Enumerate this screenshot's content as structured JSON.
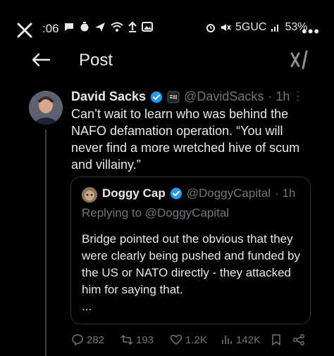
{
  "status_bar": {
    "time": ":06",
    "network": "5GUC",
    "battery": "53%",
    "more": "•••"
  },
  "header": {
    "title": "Post",
    "brand_icon": "grok-icon"
  },
  "tweet": {
    "author_name": "David Sacks",
    "handle": "@DavidSacks",
    "time": "· 1h",
    "body": "Can’t wait to learn who was behind the NAFO defamation operation. “You will never find a more wretched hive of scum and villainy.”",
    "verified_color": "#1d9bf0"
  },
  "quote": {
    "author_name": "Doggy Cap",
    "handle": "@DoggyCapital",
    "time": "· 1h",
    "replying_to": "Replying to @DoggyCapital",
    "body": "Bridge pointed out the obvious that they were clearly being pushed and funded by the US or NATO directly - they attacked him for saying that.",
    "ellipsis": "..."
  },
  "actions": {
    "replies": "282",
    "reposts": "193",
    "likes": "1.2K",
    "views": "142K"
  }
}
